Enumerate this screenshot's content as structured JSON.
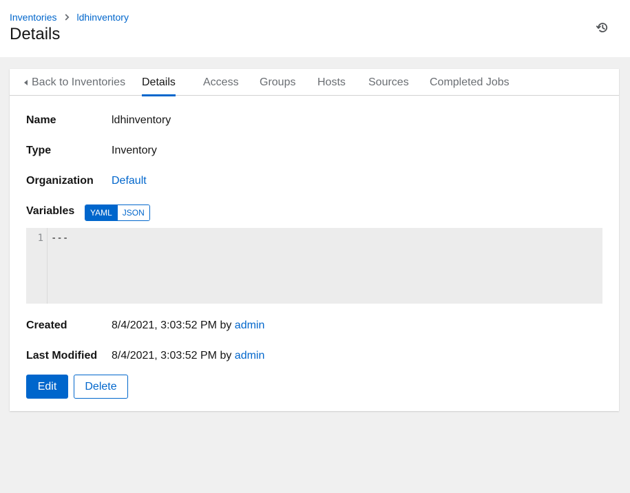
{
  "breadcrumb": {
    "root": "Inventories",
    "current": "ldhinventory"
  },
  "page": {
    "title": "Details"
  },
  "header_icons": {
    "history": "history-icon"
  },
  "tabs": [
    {
      "label": "Back to Inventories",
      "active": false
    },
    {
      "label": "Details",
      "active": true
    },
    {
      "label": "Access",
      "active": false
    },
    {
      "label": "Groups",
      "active": false
    },
    {
      "label": "Hosts",
      "active": false
    },
    {
      "label": "Sources",
      "active": false
    },
    {
      "label": "Completed Jobs",
      "active": false
    }
  ],
  "details": {
    "name": {
      "label": "Name",
      "value": "ldhinventory"
    },
    "type": {
      "label": "Type",
      "value": "Inventory"
    },
    "organization": {
      "label": "Organization",
      "value": "Default"
    },
    "variables": {
      "label": "Variables",
      "toggle_yaml": "YAML",
      "toggle_json": "JSON",
      "selected": "YAML",
      "line_number": "1",
      "content": "---"
    },
    "created": {
      "label": "Created",
      "date": "8/4/2021, 3:03:52 PM by",
      "user": "admin"
    },
    "modified": {
      "label": "Last Modified",
      "date": "8/4/2021, 3:03:52 PM by",
      "user": "admin"
    }
  },
  "actions": {
    "edit": "Edit",
    "delete": "Delete"
  },
  "colors": {
    "accent": "#0066cc",
    "background": "#f0f0f0",
    "text": "#151515",
    "muted": "#6a6e73"
  }
}
